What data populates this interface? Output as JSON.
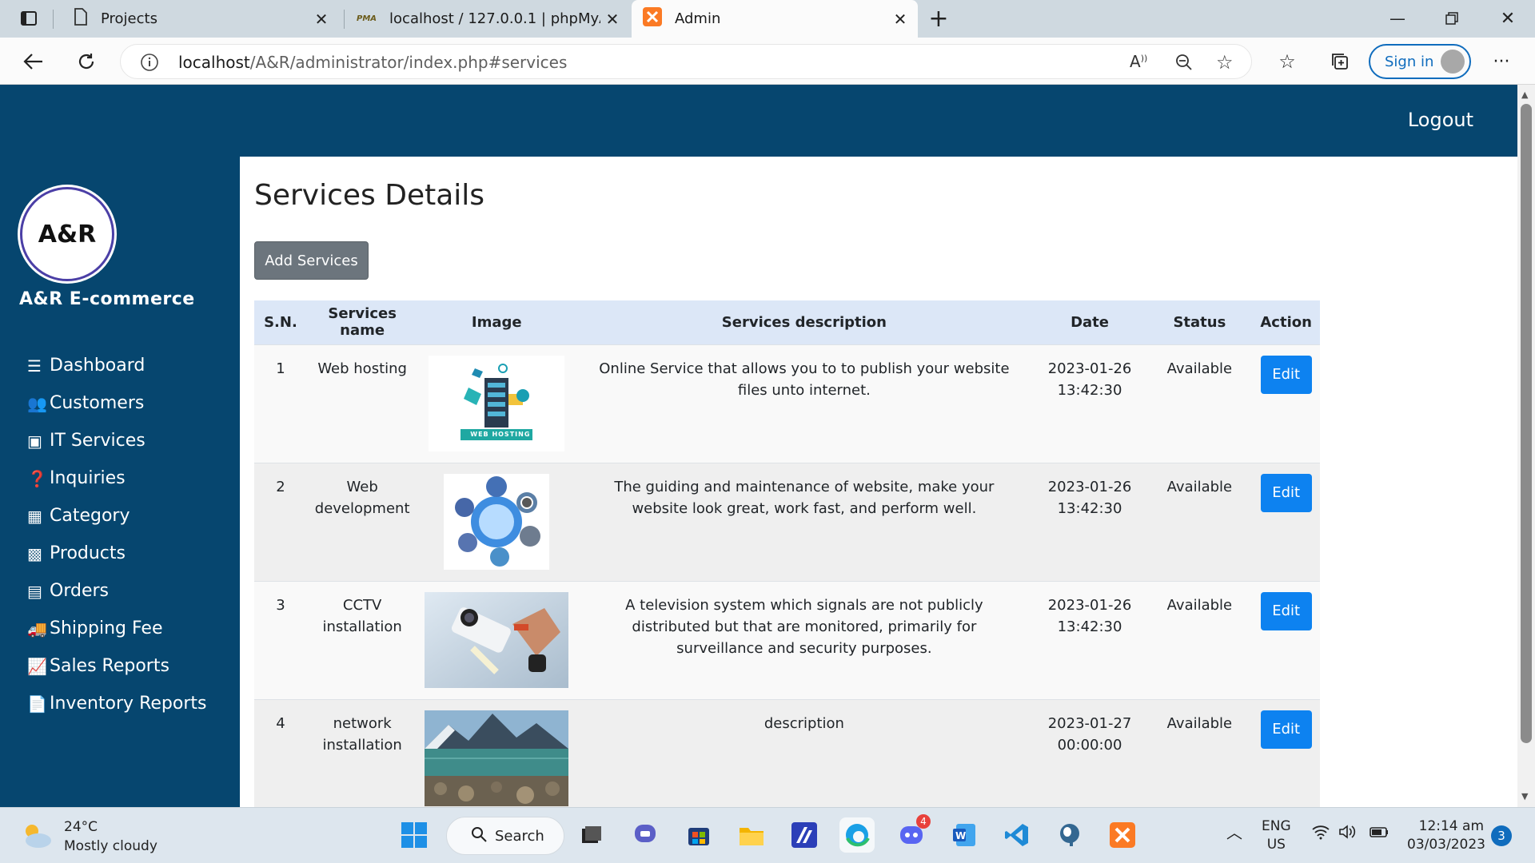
{
  "browser": {
    "tabs": [
      {
        "label": "Projects"
      },
      {
        "label": "localhost / 127.0.0.1 | phpMyAdn",
        "icon_text": "PMA"
      },
      {
        "label": "Admin"
      }
    ],
    "url_host": "localhost",
    "url_path": "/A&R/administrator/index.php#services",
    "signin_label": "Sign in"
  },
  "header": {
    "logout_label": "Logout"
  },
  "sidebar": {
    "logo_text": "A&R",
    "brand": "A&R E-commerce",
    "items": [
      {
        "label": "Dashboard",
        "icon": "bars-icon"
      },
      {
        "label": "Customers",
        "icon": "users-icon"
      },
      {
        "label": "IT Services",
        "icon": "rss-icon"
      },
      {
        "label": "Inquiries",
        "icon": "question-icon"
      },
      {
        "label": "Category",
        "icon": "grid-icon"
      },
      {
        "label": "Products",
        "icon": "th-icon"
      },
      {
        "label": "Orders",
        "icon": "list-icon"
      },
      {
        "label": "Shipping Fee",
        "icon": "truck-icon"
      },
      {
        "label": "Sales Reports",
        "icon": "chart-icon"
      },
      {
        "label": "Inventory Reports",
        "icon": "file-icon"
      }
    ]
  },
  "main": {
    "title": "Services Details",
    "add_button": "Add Services",
    "columns": [
      "S.N.",
      "Services name",
      "Image",
      "Services description",
      "Date",
      "Status",
      "Action"
    ],
    "rows": [
      {
        "sn": "1",
        "name": "Web hosting",
        "image_text": "WEB HOSTING",
        "description": "Online Service that allows you to to publish your website files unto internet.",
        "date": "2023-01-26",
        "time": "13:42:30",
        "status": "Available",
        "action": "Edit"
      },
      {
        "sn": "2",
        "name": "Web development",
        "image_text": "",
        "description": "The guiding and maintenance of website, make your website look great, work fast, and perform well.",
        "date": "2023-01-26",
        "time": "13:42:30",
        "status": "Available",
        "action": "Edit"
      },
      {
        "sn": "3",
        "name": "CCTV installation",
        "image_text": "",
        "description": "A television system which signals are not publicly distributed but that are monitored, primarily for surveillance and security purposes.",
        "date": "2023-01-26",
        "time": "13:42:30",
        "status": "Available",
        "action": "Edit"
      },
      {
        "sn": "4",
        "name": "network installation",
        "image_text": "",
        "description": "description",
        "date": "2023-01-27",
        "time": "00:00:00",
        "status": "Available",
        "action": "Edit"
      }
    ]
  },
  "taskbar": {
    "weather_temp": "24°C",
    "weather_desc": "Mostly cloudy",
    "search_label": "Search",
    "discord_badge": "4",
    "lang_1": "ENG",
    "lang_2": "US",
    "time": "12:14 am",
    "date": "03/03/2023",
    "notifications": "3"
  },
  "colors": {
    "sidebar": "#06466f",
    "table_header": "#dce7f7",
    "edit_button": "#0d82f0",
    "add_button": "#6c757d"
  }
}
